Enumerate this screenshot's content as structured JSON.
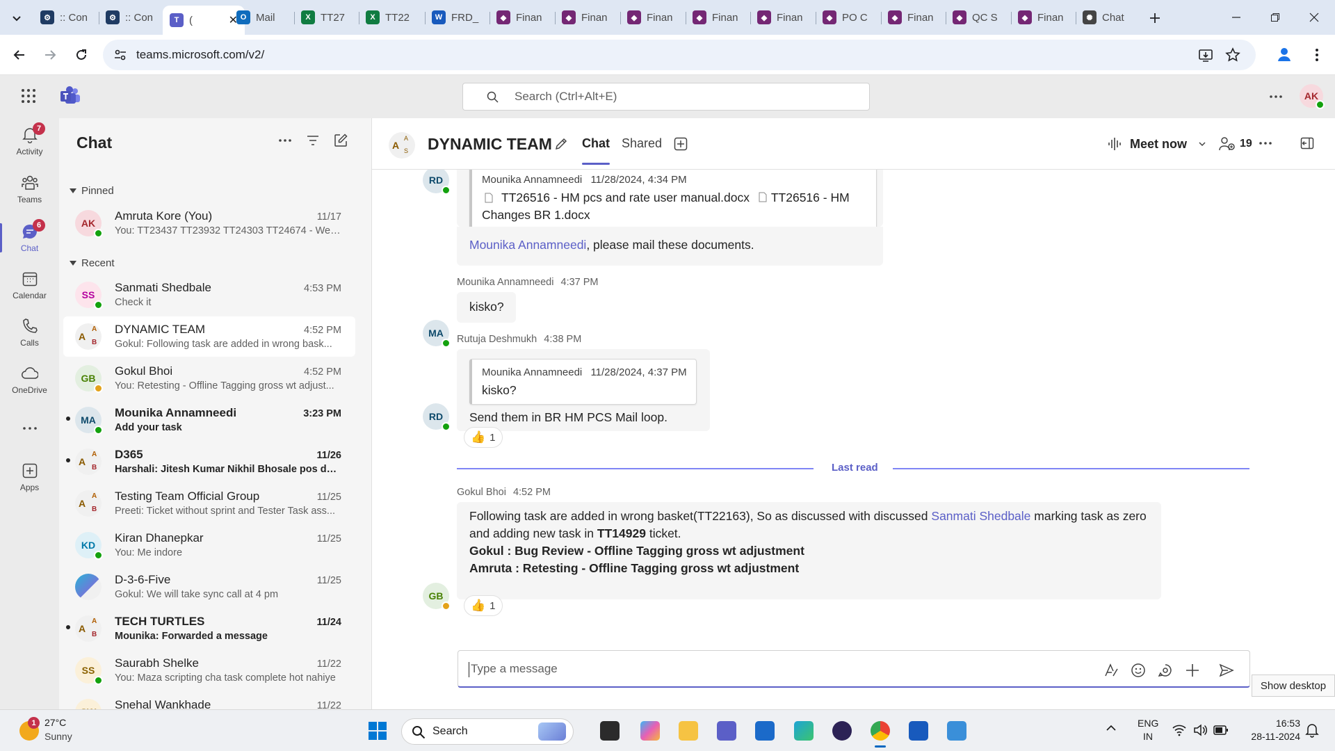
{
  "browser": {
    "tabs": [
      {
        "label": ":: Con",
        "icon": "app-icon",
        "color": "#1f3b63"
      },
      {
        "label": ":: Con",
        "icon": "app-icon",
        "color": "#1f3b63"
      },
      {
        "label": "(",
        "icon": "teams-icon",
        "color": "#5b5fc7",
        "active": true
      },
      {
        "label": "Mail",
        "icon": "outlook-icon",
        "color": "#0f6cbd"
      },
      {
        "label": "TT27",
        "icon": "excel-icon",
        "color": "#107c41"
      },
      {
        "label": "TT22",
        "icon": "excel-icon",
        "color": "#107c41"
      },
      {
        "label": "FRD_",
        "icon": "word-icon",
        "color": "#185abd"
      },
      {
        "label": "Finan",
        "icon": "powerapps-icon",
        "color": "#742774"
      },
      {
        "label": "Finan",
        "icon": "powerapps-icon",
        "color": "#742774"
      },
      {
        "label": "Finan",
        "icon": "powerapps-icon",
        "color": "#742774"
      },
      {
        "label": "Finan",
        "icon": "powerapps-icon",
        "color": "#742774"
      },
      {
        "label": "Finan",
        "icon": "powerapps-icon",
        "color": "#742774"
      },
      {
        "label": "PO C",
        "icon": "powerapps-icon",
        "color": "#742774"
      },
      {
        "label": "Finan",
        "icon": "powerapps-icon",
        "color": "#742774"
      },
      {
        "label": "QC S",
        "icon": "powerapps-icon",
        "color": "#742774"
      },
      {
        "label": "Finan",
        "icon": "powerapps-icon",
        "color": "#742774"
      },
      {
        "label": "Chat",
        "icon": "chatgpt-icon",
        "color": "#444444"
      }
    ],
    "url": "teams.microsoft.com/v2/"
  },
  "teams": {
    "search_placeholder": "Search (Ctrl+Alt+E)",
    "user_initials": "AK",
    "accent": "#5b5fc7"
  },
  "rail": [
    {
      "label": "Activity",
      "icon": "bell-icon",
      "badge": "7"
    },
    {
      "label": "Teams",
      "icon": "teams-people-icon",
      "badge": ""
    },
    {
      "label": "Chat",
      "icon": "chat-icon",
      "badge": "6",
      "active": true
    },
    {
      "label": "Calendar",
      "icon": "calendar-icon",
      "badge": ""
    },
    {
      "label": "Calls",
      "icon": "phone-icon",
      "badge": ""
    },
    {
      "label": "OneDrive",
      "icon": "cloud-icon",
      "badge": ""
    },
    {
      "label": "",
      "icon": "more-icon",
      "badge": ""
    },
    {
      "label": "Apps",
      "icon": "apps-add-icon",
      "badge": ""
    }
  ],
  "chatlist": {
    "title": "Chat",
    "pinned_label": "Pinned",
    "recent_label": "Recent",
    "pinned": [
      {
        "initials": "AK",
        "name": "Amruta Kore (You)",
        "time": "11/17",
        "preview": "You: TT23437 TT23932 TT24303 TT24674 - Wei...",
        "avatar_color": "#f7d9de",
        "avatar_text": "#a4262c",
        "presence": "available"
      }
    ],
    "recent": [
      {
        "initials": "SS",
        "name": "Sanmati Shedbale",
        "time": "4:53 PM",
        "preview": "Check it",
        "avatar_color": "#fde4ec",
        "avatar_text": "#b4009e",
        "presence": "available",
        "unread": false,
        "group": false
      },
      {
        "initials": "A",
        "name": "DYNAMIC TEAM",
        "time": "4:52 PM",
        "preview": "Gokul: Following task are added in wrong bask...",
        "avatar_color": "#f0f0f0",
        "avatar_text": "#8a5a00",
        "presence": "",
        "unread": false,
        "group": true,
        "selected": true
      },
      {
        "initials": "GB",
        "name": "Gokul Bhoi",
        "time": "4:52 PM",
        "preview": "You: Retesting - Offline Tagging gross wt adjust...",
        "avatar_color": "#e3efe0",
        "avatar_text": "#498205",
        "presence": "away",
        "unread": false,
        "group": false
      },
      {
        "initials": "MA",
        "name": "Mounika Annamneedi",
        "time": "3:23 PM",
        "preview": "Add your task",
        "avatar_color": "#dce6ec",
        "avatar_text": "#0e4a6b",
        "presence": "available",
        "unread": true,
        "group": false
      },
      {
        "initials": "A",
        "name": "D365",
        "time": "11/26",
        "preview": "Harshali: Jitesh Kumar Nikhil Bhosale pos doc...",
        "avatar_color": "#f0f0f0",
        "avatar_text": "#8a5a00",
        "presence": "",
        "unread": true,
        "group": true
      },
      {
        "initials": "A",
        "name": "Testing Team Official Group",
        "time": "11/25",
        "preview": "Preeti: Ticket without sprint and Tester Task ass...",
        "avatar_color": "#f0f0f0",
        "avatar_text": "#8a5a00",
        "presence": "",
        "unread": false,
        "group": true
      },
      {
        "initials": "KD",
        "name": "Kiran Dhanepkar",
        "time": "11/25",
        "preview": "You: Me indore",
        "avatar_color": "#def0f7",
        "avatar_text": "#0078a8",
        "presence": "available",
        "unread": false,
        "group": false
      },
      {
        "initials": "",
        "name": "D-3-6-Five",
        "time": "11/25",
        "preview": "Gokul: We will take sync call at 4 pm",
        "avatar_color": "#6c7bd8",
        "avatar_text": "#ffffff",
        "presence": "",
        "unread": false,
        "group": false,
        "image": true
      },
      {
        "initials": "A",
        "name": "TECH TURTLES",
        "time": "11/24",
        "preview": "Mounika: Forwarded a message",
        "avatar_color": "#f0f0f0",
        "avatar_text": "#8a5a00",
        "presence": "",
        "unread": true,
        "group": true
      },
      {
        "initials": "SS",
        "name": "Saurabh Shelke",
        "time": "11/22",
        "preview": "You: Maza scripting cha task complete hot nahiye",
        "avatar_color": "#fbf0d9",
        "avatar_text": "#8a6100",
        "presence": "available",
        "unread": false,
        "group": false
      },
      {
        "initials": "SW",
        "name": "Snehal Wankhade",
        "time": "11/22",
        "preview": "",
        "avatar_color": "#fbf0d9",
        "avatar_text": "#8a6100",
        "presence": "",
        "unread": false,
        "group": false
      }
    ]
  },
  "conversation": {
    "title": "DYNAMIC TEAM",
    "tabs": {
      "chat": "Chat",
      "shared": "Shared"
    },
    "meet_now": "Meet now",
    "participants": "19",
    "messages": {
      "m1": {
        "initials": "RD",
        "quote_author": "Mounika Annamneedi",
        "quote_time": "11/28/2024, 4:34 PM",
        "file1": "TT26516 - HM pcs and rate user manual.docx",
        "file2": "TT26516 - HM",
        "file2_cont": "Changes BR 1.docx",
        "mention": "Mounika Annamneedi",
        "text": ", please mail these documents."
      },
      "m2": {
        "initials": "MA",
        "author": "Mounika Annamneedi",
        "time": "4:37 PM",
        "text": "kisko?"
      },
      "m3": {
        "initials": "RD",
        "author": "Rutuja Deshmukh",
        "time": "4:38 PM",
        "quote_author": "Mounika Annamneedi",
        "quote_time": "11/28/2024, 4:37 PM",
        "quote_text": "kisko?",
        "text": "Send them in BR HM PCS Mail loop.",
        "reaction_emoji": "👍",
        "reaction_count": "1"
      },
      "last_read": "Last read",
      "m4": {
        "initials": "GB",
        "author": "Gokul Bhoi",
        "time": "4:52 PM",
        "line1a": "Following task are added in wrong basket(TT22163), So as discussed with discussed",
        "mention": "Sanmati Shedbale",
        "line1b": "marking task as zero",
        "line2a": "and adding new task in",
        "line2b": "TT14929",
        "line2c": "ticket.",
        "line3": "Gokul : Bug Review - Offline Tagging gross wt adjustment",
        "line4": "Amruta : Retesting - Offline Tagging gross wt adjustment",
        "reaction_emoji": "👍",
        "reaction_count": "1"
      }
    },
    "composer_placeholder": "Type a message"
  },
  "tooltip": "Show desktop",
  "taskbar": {
    "weather_temp": "27°C",
    "weather_text": "Sunny",
    "weather_badge": "1",
    "search": "Search",
    "lang1": "ENG",
    "lang2": "IN",
    "time": "16:53",
    "date": "28-11-2024"
  }
}
